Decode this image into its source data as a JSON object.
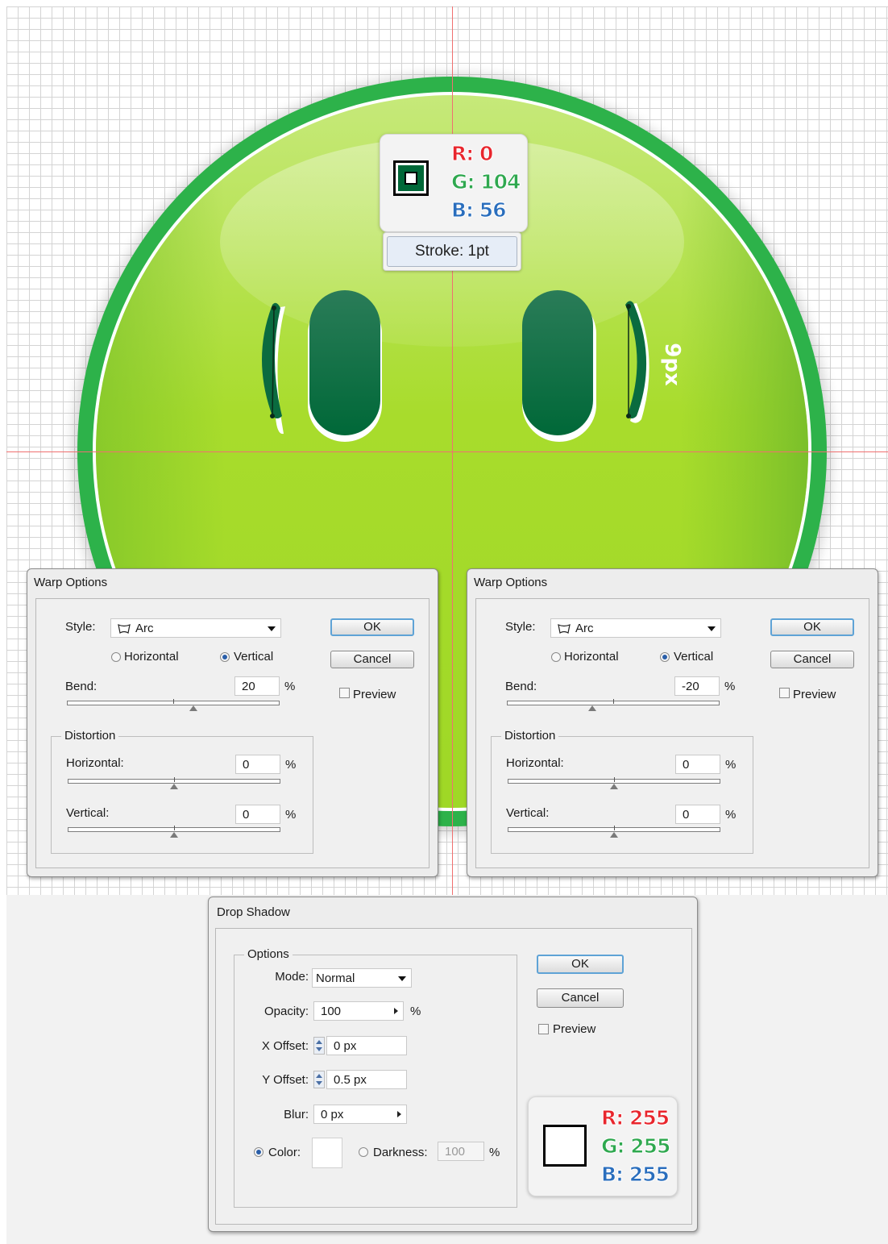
{
  "canvas": {
    "dimension_label": "9px",
    "fill_color": {
      "r": 0,
      "g": 104,
      "b": 56,
      "hex": "#006838"
    },
    "popup": {
      "r_text": "R: 0",
      "g_text": "G: 104",
      "b_text": "B: 56"
    },
    "stroke_label": "Stroke: 1pt"
  },
  "warp_left": {
    "title": "Warp Options",
    "style_label": "Style:",
    "style_value": "Arc",
    "horizontal_label": "Horizontal",
    "vertical_label": "Vertical",
    "orientation": "Vertical",
    "bend_label": "Bend:",
    "bend_value": "20",
    "percent": "%",
    "distortion_label": "Distortion",
    "dist_horizontal_label": "Horizontal:",
    "dist_horizontal_value": "0",
    "dist_vertical_label": "Vertical:",
    "dist_vertical_value": "0",
    "ok_label": "OK",
    "cancel_label": "Cancel",
    "preview_label": "Preview"
  },
  "warp_right": {
    "title": "Warp Options",
    "style_label": "Style:",
    "style_value": "Arc",
    "horizontal_label": "Horizontal",
    "vertical_label": "Vertical",
    "orientation": "Vertical",
    "bend_label": "Bend:",
    "bend_value": "-20",
    "percent": "%",
    "distortion_label": "Distortion",
    "dist_horizontal_label": "Horizontal:",
    "dist_horizontal_value": "0",
    "dist_vertical_label": "Vertical:",
    "dist_vertical_value": "0",
    "ok_label": "OK",
    "cancel_label": "Cancel",
    "preview_label": "Preview"
  },
  "drop_shadow": {
    "title": "Drop Shadow",
    "options_label": "Options",
    "mode_label": "Mode:",
    "mode_value": "Normal",
    "opacity_label": "Opacity:",
    "opacity_value": "100",
    "percent": "%",
    "x_offset_label": "X Offset:",
    "x_offset_value": "0 px",
    "y_offset_label": "Y Offset:",
    "y_offset_value": "0.5 px",
    "blur_label": "Blur:",
    "blur_value": "0 px",
    "color_label": "Color:",
    "darkness_label": "Darkness:",
    "darkness_value": "100",
    "ok_label": "OK",
    "cancel_label": "Cancel",
    "preview_label": "Preview",
    "shadow_color": {
      "r_text": "R: 255",
      "g_text": "G: 255",
      "b_text": "B: 255",
      "hex": "#ffffff"
    }
  }
}
